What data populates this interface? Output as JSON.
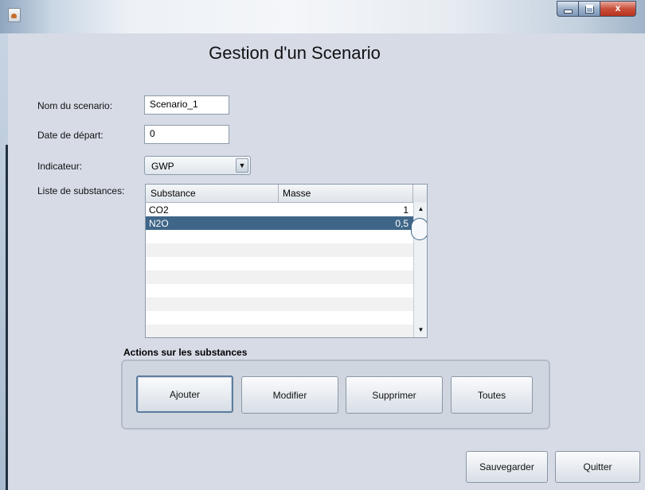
{
  "window": {
    "title": "",
    "controls": {
      "minimize": "minimize-icon",
      "maximize": "maximize-icon",
      "close": "x"
    }
  },
  "heading": "Gestion d'un Scenario",
  "form": {
    "name_label": "Nom du scenario:",
    "name_value": "Scenario_1",
    "date_label": "Date de départ:",
    "date_value": "0",
    "indicator_label": "Indicateur:",
    "indicator_value": "GWP",
    "substances_label": "Liste de substances:"
  },
  "table": {
    "columns": [
      "Substance",
      "Masse"
    ],
    "rows": [
      {
        "substance": "CO2",
        "masse": "1",
        "selected": false
      },
      {
        "substance": "N2O",
        "masse": "0,5",
        "selected": true
      }
    ]
  },
  "actions": {
    "group_title": "Actions sur les substances",
    "add": "Ajouter",
    "modify": "Modifier",
    "delete": "Supprimer",
    "all": "Toutes"
  },
  "footer": {
    "save": "Sauvegarder",
    "quit": "Quitter"
  },
  "colors": {
    "window_bg": "#d6dbe6",
    "selection": "#3f6688",
    "close_button": "#c9503b"
  }
}
